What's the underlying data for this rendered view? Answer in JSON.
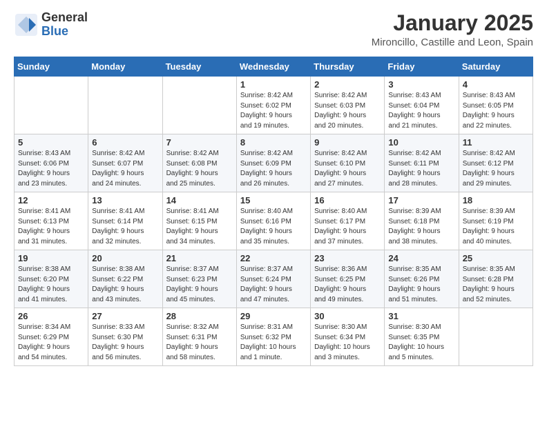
{
  "logo": {
    "general": "General",
    "blue": "Blue"
  },
  "header": {
    "month": "January 2025",
    "location": "Mironcillo, Castille and Leon, Spain"
  },
  "weekdays": [
    "Sunday",
    "Monday",
    "Tuesday",
    "Wednesday",
    "Thursday",
    "Friday",
    "Saturday"
  ],
  "weeks": [
    [
      {
        "day": "",
        "info": ""
      },
      {
        "day": "",
        "info": ""
      },
      {
        "day": "",
        "info": ""
      },
      {
        "day": "1",
        "info": "Sunrise: 8:42 AM\nSunset: 6:02 PM\nDaylight: 9 hours\nand 19 minutes."
      },
      {
        "day": "2",
        "info": "Sunrise: 8:42 AM\nSunset: 6:03 PM\nDaylight: 9 hours\nand 20 minutes."
      },
      {
        "day": "3",
        "info": "Sunrise: 8:43 AM\nSunset: 6:04 PM\nDaylight: 9 hours\nand 21 minutes."
      },
      {
        "day": "4",
        "info": "Sunrise: 8:43 AM\nSunset: 6:05 PM\nDaylight: 9 hours\nand 22 minutes."
      }
    ],
    [
      {
        "day": "5",
        "info": "Sunrise: 8:43 AM\nSunset: 6:06 PM\nDaylight: 9 hours\nand 23 minutes."
      },
      {
        "day": "6",
        "info": "Sunrise: 8:42 AM\nSunset: 6:07 PM\nDaylight: 9 hours\nand 24 minutes."
      },
      {
        "day": "7",
        "info": "Sunrise: 8:42 AM\nSunset: 6:08 PM\nDaylight: 9 hours\nand 25 minutes."
      },
      {
        "day": "8",
        "info": "Sunrise: 8:42 AM\nSunset: 6:09 PM\nDaylight: 9 hours\nand 26 minutes."
      },
      {
        "day": "9",
        "info": "Sunrise: 8:42 AM\nSunset: 6:10 PM\nDaylight: 9 hours\nand 27 minutes."
      },
      {
        "day": "10",
        "info": "Sunrise: 8:42 AM\nSunset: 6:11 PM\nDaylight: 9 hours\nand 28 minutes."
      },
      {
        "day": "11",
        "info": "Sunrise: 8:42 AM\nSunset: 6:12 PM\nDaylight: 9 hours\nand 29 minutes."
      }
    ],
    [
      {
        "day": "12",
        "info": "Sunrise: 8:41 AM\nSunset: 6:13 PM\nDaylight: 9 hours\nand 31 minutes."
      },
      {
        "day": "13",
        "info": "Sunrise: 8:41 AM\nSunset: 6:14 PM\nDaylight: 9 hours\nand 32 minutes."
      },
      {
        "day": "14",
        "info": "Sunrise: 8:41 AM\nSunset: 6:15 PM\nDaylight: 9 hours\nand 34 minutes."
      },
      {
        "day": "15",
        "info": "Sunrise: 8:40 AM\nSunset: 6:16 PM\nDaylight: 9 hours\nand 35 minutes."
      },
      {
        "day": "16",
        "info": "Sunrise: 8:40 AM\nSunset: 6:17 PM\nDaylight: 9 hours\nand 37 minutes."
      },
      {
        "day": "17",
        "info": "Sunrise: 8:39 AM\nSunset: 6:18 PM\nDaylight: 9 hours\nand 38 minutes."
      },
      {
        "day": "18",
        "info": "Sunrise: 8:39 AM\nSunset: 6:19 PM\nDaylight: 9 hours\nand 40 minutes."
      }
    ],
    [
      {
        "day": "19",
        "info": "Sunrise: 8:38 AM\nSunset: 6:20 PM\nDaylight: 9 hours\nand 41 minutes."
      },
      {
        "day": "20",
        "info": "Sunrise: 8:38 AM\nSunset: 6:22 PM\nDaylight: 9 hours\nand 43 minutes."
      },
      {
        "day": "21",
        "info": "Sunrise: 8:37 AM\nSunset: 6:23 PM\nDaylight: 9 hours\nand 45 minutes."
      },
      {
        "day": "22",
        "info": "Sunrise: 8:37 AM\nSunset: 6:24 PM\nDaylight: 9 hours\nand 47 minutes."
      },
      {
        "day": "23",
        "info": "Sunrise: 8:36 AM\nSunset: 6:25 PM\nDaylight: 9 hours\nand 49 minutes."
      },
      {
        "day": "24",
        "info": "Sunrise: 8:35 AM\nSunset: 6:26 PM\nDaylight: 9 hours\nand 51 minutes."
      },
      {
        "day": "25",
        "info": "Sunrise: 8:35 AM\nSunset: 6:28 PM\nDaylight: 9 hours\nand 52 minutes."
      }
    ],
    [
      {
        "day": "26",
        "info": "Sunrise: 8:34 AM\nSunset: 6:29 PM\nDaylight: 9 hours\nand 54 minutes."
      },
      {
        "day": "27",
        "info": "Sunrise: 8:33 AM\nSunset: 6:30 PM\nDaylight: 9 hours\nand 56 minutes."
      },
      {
        "day": "28",
        "info": "Sunrise: 8:32 AM\nSunset: 6:31 PM\nDaylight: 9 hours\nand 58 minutes."
      },
      {
        "day": "29",
        "info": "Sunrise: 8:31 AM\nSunset: 6:32 PM\nDaylight: 10 hours\nand 1 minute."
      },
      {
        "day": "30",
        "info": "Sunrise: 8:30 AM\nSunset: 6:34 PM\nDaylight: 10 hours\nand 3 minutes."
      },
      {
        "day": "31",
        "info": "Sunrise: 8:30 AM\nSunset: 6:35 PM\nDaylight: 10 hours\nand 5 minutes."
      },
      {
        "day": "",
        "info": ""
      }
    ]
  ]
}
